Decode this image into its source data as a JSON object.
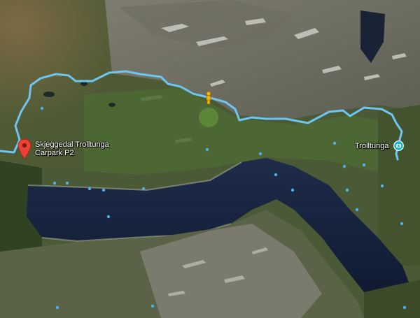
{
  "places": [
    {
      "id": "carpark",
      "label": "Skjeggedal Trolltunga Carpark P2",
      "icon": "red-location-pin-icon"
    },
    {
      "id": "trolltunga",
      "label": "Trolltunga",
      "icon": "camera-poi-icon"
    }
  ],
  "route": {
    "color": "#6ec6f0"
  },
  "pegman": {
    "icon": "pegman-icon",
    "color": "#f4b400"
  },
  "colors": {
    "water": "#14203a",
    "terrain_green": "#4d6a35",
    "rock": "#8a8a80"
  }
}
